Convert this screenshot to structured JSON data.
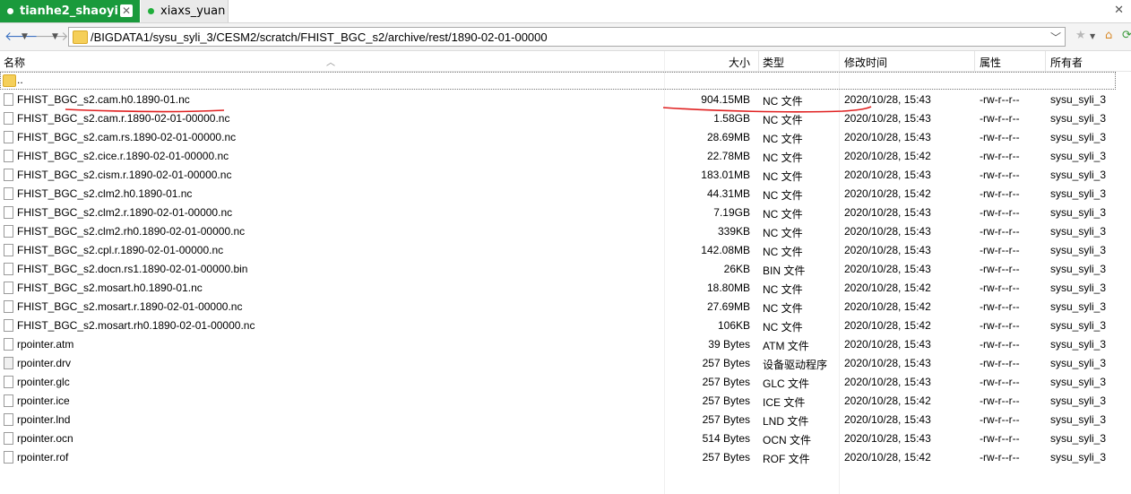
{
  "tabs": [
    {
      "label": "tianhe2_shaoyi",
      "active": true
    },
    {
      "label": "xiaxs_yuan",
      "active": false
    }
  ],
  "address": {
    "path": "/BIGDATA1/sysu_syli_3/CESM2/scratch/FHIST_BGC_s2/archive/rest/1890-02-01-00000"
  },
  "columns": {
    "name": "名称",
    "size": "大小",
    "type": "类型",
    "modified": "修改时间",
    "attributes": "属性",
    "owner": "所有者"
  },
  "parent_dir": "..",
  "files": [
    {
      "name": "FHIST_BGC_s2.cam.h0.1890-01.nc",
      "size": "904.15MB",
      "type": "NC 文件",
      "modified": "2020/10/28, 15:43",
      "perm": "-rw-r--r--",
      "owner": "sysu_syli_3"
    },
    {
      "name": "FHIST_BGC_s2.cam.r.1890-02-01-00000.nc",
      "size": "1.58GB",
      "type": "NC 文件",
      "modified": "2020/10/28, 15:43",
      "perm": "-rw-r--r--",
      "owner": "sysu_syli_3"
    },
    {
      "name": "FHIST_BGC_s2.cam.rs.1890-02-01-00000.nc",
      "size": "28.69MB",
      "type": "NC 文件",
      "modified": "2020/10/28, 15:43",
      "perm": "-rw-r--r--",
      "owner": "sysu_syli_3"
    },
    {
      "name": "FHIST_BGC_s2.cice.r.1890-02-01-00000.nc",
      "size": "22.78MB",
      "type": "NC 文件",
      "modified": "2020/10/28, 15:42",
      "perm": "-rw-r--r--",
      "owner": "sysu_syli_3"
    },
    {
      "name": "FHIST_BGC_s2.cism.r.1890-02-01-00000.nc",
      "size": "183.01MB",
      "type": "NC 文件",
      "modified": "2020/10/28, 15:43",
      "perm": "-rw-r--r--",
      "owner": "sysu_syli_3"
    },
    {
      "name": "FHIST_BGC_s2.clm2.h0.1890-01.nc",
      "size": "44.31MB",
      "type": "NC 文件",
      "modified": "2020/10/28, 15:42",
      "perm": "-rw-r--r--",
      "owner": "sysu_syli_3"
    },
    {
      "name": "FHIST_BGC_s2.clm2.r.1890-02-01-00000.nc",
      "size": "7.19GB",
      "type": "NC 文件",
      "modified": "2020/10/28, 15:43",
      "perm": "-rw-r--r--",
      "owner": "sysu_syli_3"
    },
    {
      "name": "FHIST_BGC_s2.clm2.rh0.1890-02-01-00000.nc",
      "size": "339KB",
      "type": "NC 文件",
      "modified": "2020/10/28, 15:43",
      "perm": "-rw-r--r--",
      "owner": "sysu_syli_3"
    },
    {
      "name": "FHIST_BGC_s2.cpl.r.1890-02-01-00000.nc",
      "size": "142.08MB",
      "type": "NC 文件",
      "modified": "2020/10/28, 15:43",
      "perm": "-rw-r--r--",
      "owner": "sysu_syli_3"
    },
    {
      "name": "FHIST_BGC_s2.docn.rs1.1890-02-01-00000.bin",
      "size": "26KB",
      "type": "BIN 文件",
      "modified": "2020/10/28, 15:43",
      "perm": "-rw-r--r--",
      "owner": "sysu_syli_3"
    },
    {
      "name": "FHIST_BGC_s2.mosart.h0.1890-01.nc",
      "size": "18.80MB",
      "type": "NC 文件",
      "modified": "2020/10/28, 15:42",
      "perm": "-rw-r--r--",
      "owner": "sysu_syli_3"
    },
    {
      "name": "FHIST_BGC_s2.mosart.r.1890-02-01-00000.nc",
      "size": "27.69MB",
      "type": "NC 文件",
      "modified": "2020/10/28, 15:42",
      "perm": "-rw-r--r--",
      "owner": "sysu_syli_3"
    },
    {
      "name": "FHIST_BGC_s2.mosart.rh0.1890-02-01-00000.nc",
      "size": "106KB",
      "type": "NC 文件",
      "modified": "2020/10/28, 15:42",
      "perm": "-rw-r--r--",
      "owner": "sysu_syli_3"
    },
    {
      "name": "rpointer.atm",
      "size": "39 Bytes",
      "type": "ATM 文件",
      "modified": "2020/10/28, 15:43",
      "perm": "-rw-r--r--",
      "owner": "sysu_syli_3"
    },
    {
      "name": "rpointer.drv",
      "size": "257 Bytes",
      "type": "设备驱动程序",
      "modified": "2020/10/28, 15:43",
      "perm": "-rw-r--r--",
      "owner": "sysu_syli_3"
    },
    {
      "name": "rpointer.glc",
      "size": "257 Bytes",
      "type": "GLC 文件",
      "modified": "2020/10/28, 15:43",
      "perm": "-rw-r--r--",
      "owner": "sysu_syli_3"
    },
    {
      "name": "rpointer.ice",
      "size": "257 Bytes",
      "type": "ICE 文件",
      "modified": "2020/10/28, 15:42",
      "perm": "-rw-r--r--",
      "owner": "sysu_syli_3"
    },
    {
      "name": "rpointer.lnd",
      "size": "257 Bytes",
      "type": "LND 文件",
      "modified": "2020/10/28, 15:43",
      "perm": "-rw-r--r--",
      "owner": "sysu_syli_3"
    },
    {
      "name": "rpointer.ocn",
      "size": "514 Bytes",
      "type": "OCN 文件",
      "modified": "2020/10/28, 15:43",
      "perm": "-rw-r--r--",
      "owner": "sysu_syli_3"
    },
    {
      "name": "rpointer.rof",
      "size": "257 Bytes",
      "type": "ROF 文件",
      "modified": "2020/10/28, 15:42",
      "perm": "-rw-r--r--",
      "owner": "sysu_syli_3"
    }
  ],
  "colors": {
    "tab_active": "#1a9a3c",
    "annotation": "#e02020",
    "folder": "#f5cf59"
  }
}
